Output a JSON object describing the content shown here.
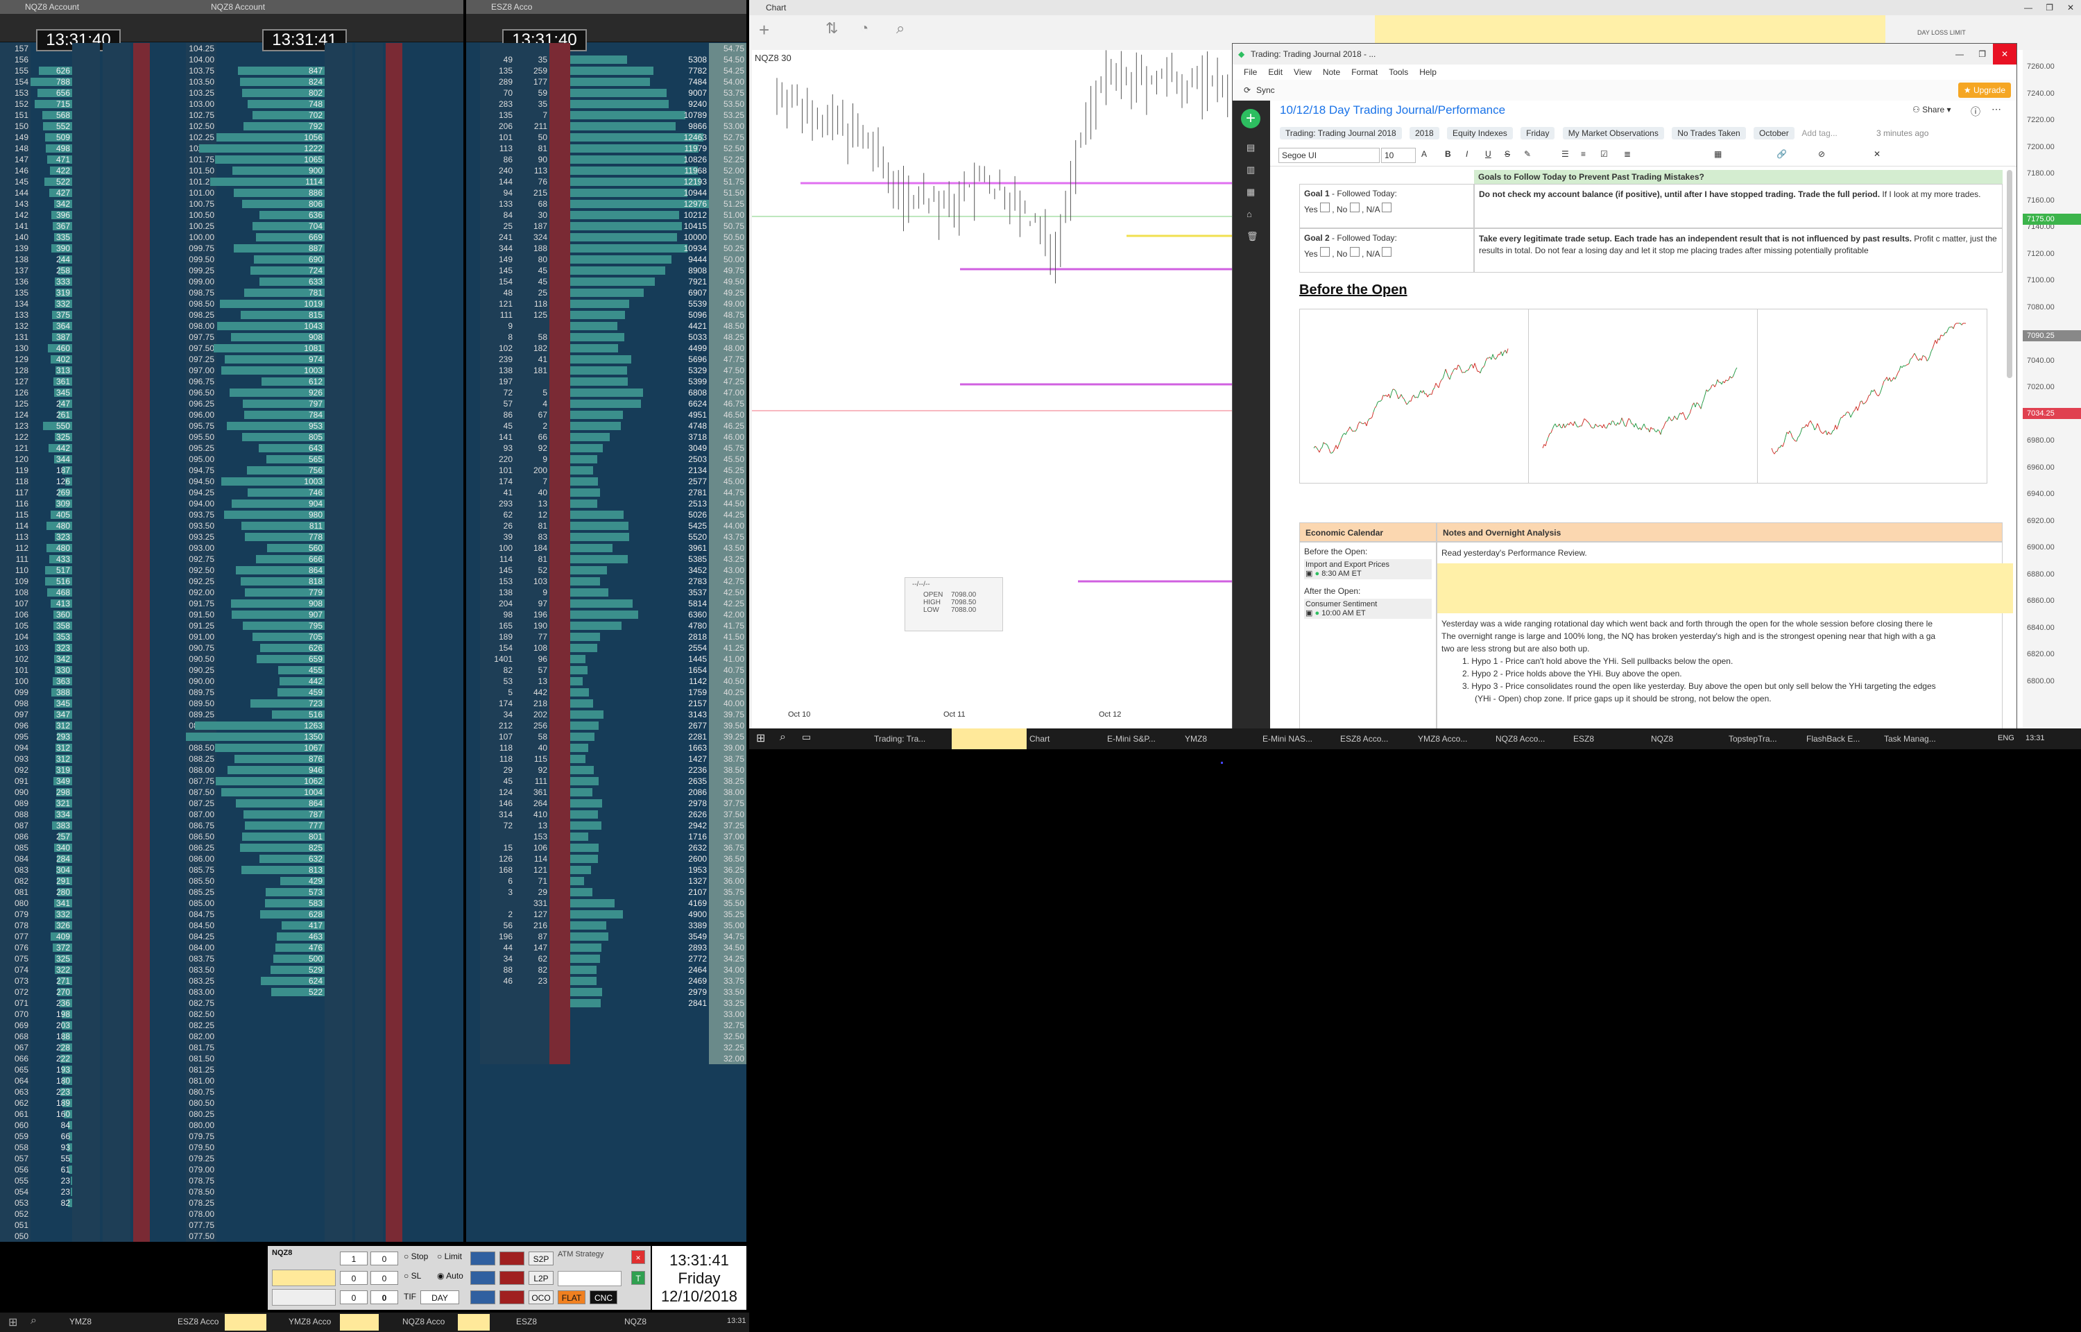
{
  "dom_windows": [
    {
      "id": "dom1",
      "title": "NQZ8 Account",
      "clock": "13:31:40"
    },
    {
      "id": "dom2",
      "title": "NQZ8 Account",
      "clock": "13:31:41"
    },
    {
      "id": "dom3",
      "title": "ESZ8 Acco",
      "clock": "13:31:40"
    }
  ],
  "dom1_prices": [
    "157",
    "156",
    "155",
    "154",
    "153",
    "152",
    "151",
    "150",
    "149",
    "148",
    "147",
    "146",
    "145",
    "144",
    "143",
    "142",
    "141",
    "140",
    "139",
    "138",
    "137",
    "136",
    "135",
    "134",
    "133",
    "132",
    "131",
    "130",
    "129",
    "128",
    "127",
    "126",
    "125",
    "124",
    "123",
    "122",
    "121",
    "120",
    "119",
    "118",
    "117",
    "116",
    "115",
    "114",
    "113",
    "112",
    "111",
    "110",
    "109",
    "108",
    "107",
    "106",
    "105",
    "104",
    "103",
    "102",
    "101",
    "100",
    "099",
    "098",
    "097",
    "096",
    "095",
    "094",
    "093",
    "092",
    "091",
    "090",
    "089",
    "088",
    "087",
    "086",
    "085",
    "084",
    "083",
    "082",
    "081",
    "080",
    "079",
    "078",
    "077",
    "076",
    "075",
    "074",
    "073",
    "072",
    "071",
    "070",
    "069",
    "068",
    "067",
    "066",
    "065",
    "064",
    "063",
    "062",
    "061",
    "060",
    "059",
    "058",
    "057",
    "056",
    "055",
    "054",
    "053",
    "052",
    "051",
    "050"
  ],
  "dom1_vol": [
    "",
    "",
    "626",
    "788",
    "656",
    "715",
    "568",
    "552",
    "509",
    "498",
    "471",
    "422",
    "522",
    "427",
    "342",
    "396",
    "367",
    "335",
    "390",
    "244",
    "258",
    "333",
    "319",
    "332",
    "375",
    "364",
    "387",
    "460",
    "402",
    "313",
    "361",
    "345",
    "247",
    "261",
    "550",
    "325",
    "442",
    "344",
    "187",
    "126",
    "269",
    "309",
    "405",
    "480",
    "323",
    "480",
    "433",
    "517",
    "516",
    "468",
    "413",
    "360",
    "358",
    "353",
    "323",
    "342",
    "330",
    "363",
    "388",
    "345",
    "347",
    "312",
    "293",
    "312",
    "312",
    "319",
    "349",
    "298",
    "321",
    "334",
    "383",
    "257",
    "340",
    "284",
    "304",
    "291",
    "280",
    "341",
    "332",
    "326",
    "409",
    "372",
    "325",
    "322",
    "271",
    "270",
    "236",
    "198",
    "203",
    "188",
    "228",
    "222",
    "193",
    "180",
    "223",
    "189",
    "160",
    "84",
    "66",
    "93",
    "55",
    "61",
    "23",
    "23",
    "82"
  ],
  "dom2_prices": [
    "104.25",
    "104.00",
    "103.75",
    "103.50",
    "103.25",
    "103.00",
    "102.75",
    "102.50",
    "102.25",
    "102.00",
    "101.75",
    "101.50",
    "101.25",
    "101.00",
    "100.75",
    "100.50",
    "100.25",
    "100.00",
    "099.75",
    "099.50",
    "099.25",
    "099.00",
    "098.75",
    "098.50",
    "098.25",
    "098.00",
    "097.75",
    "097.50",
    "097.25",
    "097.00",
    "096.75",
    "096.50",
    "096.25",
    "096.00",
    "095.75",
    "095.50",
    "095.25",
    "095.00",
    "094.75",
    "094.50",
    "094.25",
    "094.00",
    "093.75",
    "093.50",
    "093.25",
    "093.00",
    "092.75",
    "092.50",
    "092.25",
    "092.00",
    "091.75",
    "091.50",
    "091.25",
    "091.00",
    "090.75",
    "090.50",
    "090.25",
    "090.00",
    "089.75",
    "089.50",
    "089.25",
    "089.00",
    "088.75",
    "088.50",
    "088.25",
    "088.00",
    "087.75",
    "087.50",
    "087.25",
    "087.00",
    "086.75",
    "086.50",
    "086.25",
    "086.00",
    "085.75",
    "085.50",
    "085.25",
    "085.00",
    "084.75",
    "084.50",
    "084.25",
    "084.00",
    "083.75",
    "083.50",
    "083.25",
    "083.00",
    "082.75",
    "082.50",
    "082.25",
    "082.00",
    "081.75",
    "081.50",
    "081.25",
    "081.00",
    "080.75",
    "080.50",
    "080.25",
    "080.00",
    "079.75",
    "079.50",
    "079.25",
    "079.00",
    "078.75",
    "078.50",
    "078.25",
    "078.00",
    "077.75",
    "077.50"
  ],
  "dom2_vol": [
    "",
    "",
    "847",
    "824",
    "802",
    "748",
    "702",
    "792",
    "1056",
    "1222",
    "1065",
    "900",
    "1114",
    "886",
    "806",
    "636",
    "704",
    "669",
    "887",
    "690",
    "724",
    "633",
    "781",
    "1019",
    "815",
    "1043",
    "908",
    "1081",
    "974",
    "1003",
    "612",
    "926",
    "797",
    "784",
    "953",
    "805",
    "643",
    "565",
    "756",
    "1003",
    "746",
    "904",
    "980",
    "811",
    "778",
    "560",
    "666",
    "864",
    "818",
    "779",
    "908",
    "907",
    "795",
    "705",
    "626",
    "659",
    "455",
    "442",
    "459",
    "723",
    "516",
    "1263",
    "1350",
    "1067",
    "876",
    "946",
    "1062",
    "1004",
    "864",
    "787",
    "777",
    "801",
    "825",
    "632",
    "813",
    "429",
    "573",
    "583",
    "628",
    "417",
    "463",
    "476",
    "500",
    "529",
    "624",
    "522"
  ],
  "dom3_prices": [
    "54.75",
    "54.50",
    "54.25",
    "54.00",
    "53.75",
    "53.50",
    "53.25",
    "53.00",
    "52.75",
    "52.50",
    "52.25",
    "52.00",
    "51.75",
    "51.50",
    "51.25",
    "51.00",
    "50.75",
    "50.50",
    "50.25",
    "50.00",
    "49.75",
    "49.50",
    "49.25",
    "49.00",
    "48.75",
    "48.50",
    "48.25",
    "48.00",
    "47.75",
    "47.50",
    "47.25",
    "47.00",
    "46.75",
    "46.50",
    "46.25",
    "46.00",
    "45.75",
    "45.50",
    "45.25",
    "45.00",
    "44.75",
    "44.50",
    "44.25",
    "44.00",
    "43.75",
    "43.50",
    "43.25",
    "43.00",
    "42.75",
    "42.50",
    "42.25",
    "42.00",
    "41.75",
    "41.50",
    "41.25",
    "41.00",
    "40.75",
    "40.50",
    "40.25",
    "40.00",
    "39.75",
    "39.50",
    "39.25",
    "39.00",
    "38.75",
    "38.50",
    "38.25",
    "38.00",
    "37.75",
    "37.50",
    "37.25",
    "37.00",
    "36.75",
    "36.50",
    "36.25",
    "36.00",
    "35.75",
    "35.50",
    "35.25",
    "35.00",
    "34.75",
    "34.50",
    "34.25",
    "34.00",
    "33.75",
    "33.50",
    "33.25",
    "33.00",
    "32.75",
    "32.50",
    "32.25",
    "32.00"
  ],
  "dom3_vol": [
    "",
    "5308",
    "7782",
    "7484",
    "9007",
    "9240",
    "10789",
    "9866",
    "12463",
    "11979",
    "10826",
    "11968",
    "12193",
    "10944",
    "12976",
    "10212",
    "10415",
    "10000",
    "10934",
    "9444",
    "8908",
    "7921",
    "6907",
    "5539",
    "5096",
    "4421",
    "5033",
    "4499",
    "5696",
    "5329",
    "5399",
    "6808",
    "6624",
    "4951",
    "4748",
    "3718",
    "3049",
    "2503",
    "2134",
    "2577",
    "2781",
    "2513",
    "5026",
    "5425",
    "5520",
    "3961",
    "5385",
    "3452",
    "2783",
    "3537",
    "5814",
    "6360",
    "4780",
    "2818",
    "2554",
    "1445",
    "1654",
    "1142",
    "1759",
    "2157",
    "3143",
    "2677",
    "2281",
    "1663",
    "1427",
    "2236",
    "2635",
    "2086",
    "2978",
    "2626",
    "2942",
    "1716",
    "2632",
    "2600",
    "1953",
    "1327",
    "2107",
    "4169",
    "4900",
    "3389",
    "3549",
    "2893",
    "2772",
    "2464",
    "2469",
    "2979",
    "2841"
  ],
  "dom3_ask": [
    "",
    "49",
    "135",
    "289",
    "70",
    "283",
    "135",
    "206",
    "101",
    "113",
    "86",
    "240",
    "144",
    "94",
    "133",
    "84",
    "25",
    "241",
    "344",
    "149",
    "145",
    "154",
    "48",
    "121",
    "111",
    "9",
    "8",
    "102",
    "239",
    "138",
    "197",
    "72",
    "57",
    "86",
    "45",
    "141",
    "93",
    "220",
    "101",
    "174",
    "41",
    "293",
    "62",
    "26",
    "39",
    "100",
    "114",
    "145",
    "153",
    "138",
    "204",
    "98",
    "165",
    "189",
    "154",
    "1401",
    "82",
    "53",
    "5",
    "174",
    "34",
    "212",
    "107",
    "118",
    "118",
    "29",
    "45",
    "124",
    "146",
    "314",
    "72",
    "",
    "15",
    "126",
    "168",
    "6",
    "3",
    "",
    "2",
    "56",
    "196",
    "44",
    "34",
    "88",
    "46",
    ""
  ],
  "dom3_bid": [
    "",
    "35",
    "259",
    "177",
    "59",
    "35",
    "7",
    "211",
    "50",
    "81",
    "90",
    "113",
    "76",
    "215",
    "68",
    "30",
    "187",
    "324",
    "188",
    "80",
    "45",
    "45",
    "25",
    "118",
    "125",
    "",
    "58",
    "182",
    "41",
    "181",
    "",
    "5",
    "4",
    "67",
    "2",
    "66",
    "92",
    "9",
    "200",
    "7",
    "40",
    "13",
    "12",
    "81",
    "83",
    "184",
    "81",
    "52",
    "103",
    "9",
    "97",
    "196",
    "190",
    "77",
    "108",
    "96",
    "57",
    "13",
    "442",
    "218",
    "202",
    "256",
    "58",
    "40",
    "115",
    "92",
    "111",
    "361",
    "264",
    "410",
    "13",
    "153",
    "106",
    "114",
    "121",
    "71",
    "29",
    "331",
    "127",
    "216",
    "87",
    "147",
    "62",
    "82",
    "23",
    ""
  ],
  "chart": {
    "title": "Chart",
    "symbol": "NQZ8 30",
    "x_labels": [
      "Oct 10",
      "Oct 11",
      "Oct 12"
    ],
    "ohlc_box": {
      "label": "--/--/--",
      "open_label": "OPEN",
      "open": "7098.00",
      "high_label": "HIGH",
      "high": "7098.50",
      "low_label": "LOW",
      "low": "7088.00"
    },
    "day_loss_label": "DAY LOSS LIMIT",
    "y_ticks": [
      "7260.00",
      "7240.00",
      "7220.00",
      "7200.00",
      "7180.00",
      "7160.00",
      "7140.00",
      "7120.00",
      "7100.00",
      "7080.00",
      "7060.00",
      "7040.00",
      "7020.00",
      "7000.00",
      "6980.00",
      "6960.00",
      "6940.00",
      "6920.00",
      "6900.00",
      "6880.00",
      "6860.00",
      "6840.00",
      "6820.00",
      "6800.00"
    ],
    "tag_current": "7090.25",
    "tag_green": "7175.00",
    "tag_red": "7034.25"
  },
  "evernote": {
    "window_title": "Trading: Trading Journal 2018 - ...",
    "menu": [
      "File",
      "Edit",
      "View",
      "Note",
      "Format",
      "Tools",
      "Help"
    ],
    "sync": "Sync",
    "upgrade": "Upgrade",
    "note_title": "10/12/18 Day Trading Journal/Performance",
    "share": "Share",
    "notebook": "Trading: Trading Journal 2018",
    "tags": [
      "2018",
      "Equity Indexes",
      "Friday",
      "My Market Observations",
      "No Trades Taken",
      "October"
    ],
    "add_tag": "Add tag...",
    "saved": "3 minutes ago",
    "font": "Segoe UI",
    "font_size": "10",
    "goals_header": "Goals to Follow Today to Prevent Past Trading Mistakes?",
    "goal1_label": "Goal 1",
    "followed": "- Followed Today:",
    "yes": "Yes",
    "no": ", No",
    "na": ", N/A",
    "goal1_bold": "Do not check my account balance (if positive), until after I have stopped trading. Trade the full period.",
    "goal1_rest": " If I look at my more trades.",
    "goal2_label": "Goal 2",
    "goal2_bold": "Take every legitimate trade setup. Each trade has an independent result that is not influenced by past results.",
    "goal2_rest": " Profit c matter, just the results in total. Do not fear a losing day and let it stop me placing trades after missing potentially profitable",
    "before_open": "Before the Open",
    "econ_header": "Economic Calendar",
    "notes_header": "Notes and Overnight Analysis",
    "before_open_label": "Before the Open:",
    "econ1": "Import and Export Prices",
    "econ1_time": "8:30 AM ET",
    "after_open_label": "After the Open:",
    "econ2": "Consumer Sentiment",
    "econ2_time": "10:00 AM ET",
    "read_review": "Read yesterday's Performance Review.",
    "para1": "Yesterday was a wide ranging rotational day which went back and forth through the open for the whole session before closing there le",
    "para2": "The overnight range is large and 100% long, the NQ has broken yesterday's high and is the strongest opening near that high with a ga",
    "para3": "two are less strong but are also both up.",
    "hypo1": "1.  Hypo 1 - Price can't hold above the YHi. Sell pullbacks below the open.",
    "hypo2": "2.  Hypo 2 - Price holds above the YHi. Buy above the open.",
    "hypo3": "3.  Hypo 3 - Price consolidates round the open like yesterday. Buy above the open but only sell below the YHi targeting the edges",
    "hypo3b": "(YHi - Open) chop zone. If price gaps up it should be strong, not below the open."
  },
  "taskbar_right": {
    "items": [
      "Trading: Tra...",
      "",
      "Chart",
      "E-Mini S&P...",
      "YMZ8",
      "E-Mini NAS...",
      "ESZ8 Acco...",
      "YMZ8 Acco...",
      "NQZ8 Acco...",
      "ESZ8",
      "NQZ8",
      "TopstepTra...",
      "FlashBack E...",
      "Task Manag..."
    ],
    "lang": "ENG",
    "time": "13:31"
  },
  "taskbar_left": {
    "items": [
      "YMZ8",
      "ESZ8 Acco",
      "YMZ8 Acco",
      "NQZ8 Acco",
      "ESZ8",
      "NQZ8"
    ],
    "time": "13:31"
  },
  "order_panel": {
    "symbol": "NQZ8",
    "qty1": "1",
    "qty2": "0",
    "qty3": "0",
    "qty4": "0",
    "qty5": "0",
    "qty6": "0",
    "stop": "Stop",
    "limit": "Limit",
    "sl": "SL",
    "auto": "Auto",
    "tif": "TIF",
    "day": "DAY",
    "atm": "ATM Strategy",
    "btns": [
      "S2P",
      "L2P",
      "OCO",
      "FLAT",
      "CNC"
    ]
  },
  "big_clock": {
    "time": "13:31:41",
    "day": "Friday",
    "date": "12/10/2018"
  }
}
